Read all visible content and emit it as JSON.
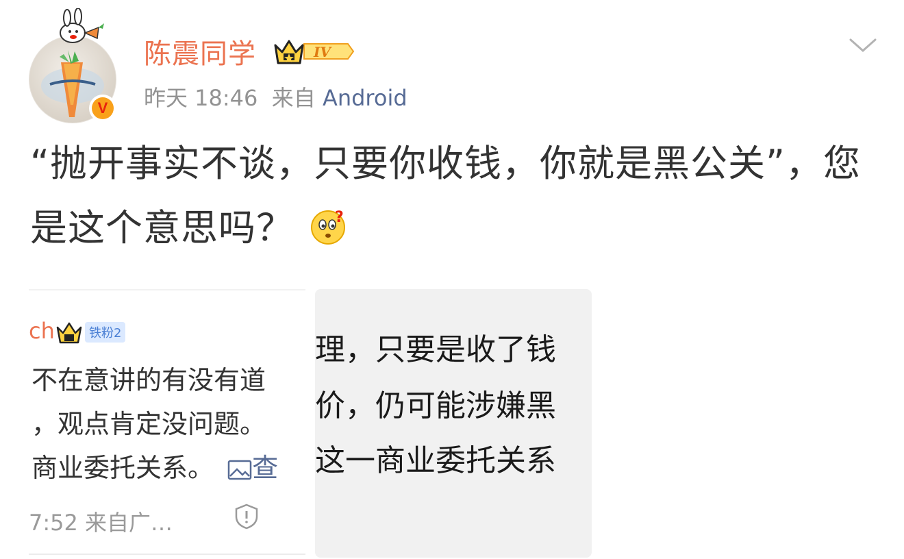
{
  "post": {
    "username": "陈震同学",
    "vip_level": "IV",
    "verified_mark": "V",
    "time": "昨天 18:46",
    "source_prefix": "来自",
    "source": "Android",
    "text": "“抛开事实不谈，只要你收钱，你就是黑公关”，您是这个意思吗？",
    "emoji": "thinking-face-emoji"
  },
  "image1": {
    "username_fragment": "ch",
    "fan_badge": "铁粉2",
    "lines": [
      "不在意讲的有没有道",
      "，观点肯定没问题。",
      "商业委托关系。"
    ],
    "view_image_glyph": "查",
    "footer": "7:52 来自广…"
  },
  "image2": {
    "lines": [
      "理，只要是收了钱",
      "价，仍可能涉嫌黑",
      "这一商业委托关系"
    ]
  },
  "colors": {
    "username": "#eb7350",
    "source_link": "#576b95",
    "meta": "#939393",
    "text": "#333333"
  }
}
